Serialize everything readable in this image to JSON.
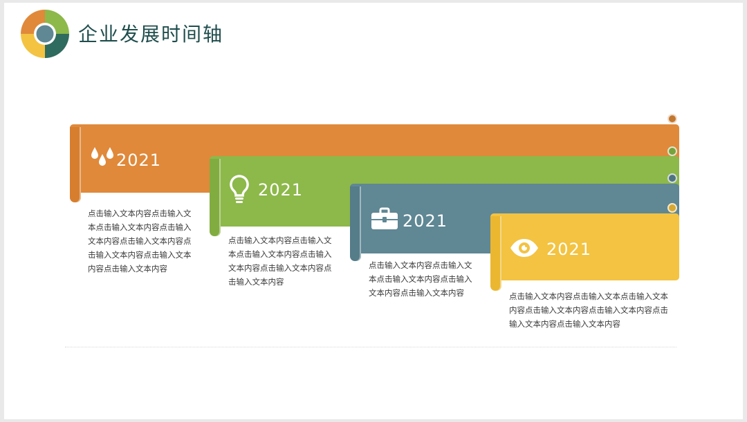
{
  "title": "企业发展时间轴",
  "colors": {
    "orange": "#e0893a",
    "green": "#8db84a",
    "slate": "#5f8794",
    "yellow": "#f3c341",
    "title": "#1f4e4d"
  },
  "milestones": [
    {
      "year": "2021",
      "icon": "water-drops-icon",
      "text": "点击输入文本内容点击输入文本点击输入文本内容点击输入文本内容点击输入文本内容点击输入文本内容点击输入文本内容点击输入文本内容"
    },
    {
      "year": "2021",
      "icon": "lightbulb-icon",
      "text": "点击输入文本内容点击输入文本点击输入文本内容点击输入文本内容点击输入文本内容点击输入文本内容"
    },
    {
      "year": "2021",
      "icon": "briefcase-icon",
      "text": "点击输入文本内容点击输入文本点击输入文本内容点击输入文本内容点击输入文本内容"
    },
    {
      "year": "2021",
      "icon": "eye-icon",
      "text": "点击输入文本内容点击输入文本点击输入文本内容点击输入文本内容点击输入文本内容点击输入文本内容点击输入文本内容"
    }
  ]
}
